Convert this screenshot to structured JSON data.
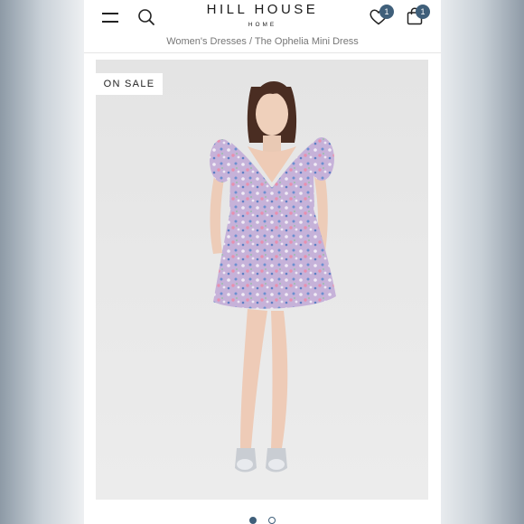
{
  "brand": {
    "name": "HILL HOUSE",
    "tagline": "HOME"
  },
  "header": {
    "menu_icon": "hamburger-menu-icon",
    "search_icon": "search-icon",
    "wishlist_icon": "heart-icon",
    "wishlist_count": "1",
    "cart_icon": "shopping-bag-icon",
    "cart_count": "1"
  },
  "breadcrumb": {
    "parent": "Women's Dresses",
    "separator": "/",
    "current": "The Ophelia Mini Dress"
  },
  "product": {
    "sale_badge": "ON SALE",
    "image_alt": "Model wearing a short-sleeved lavender floral print mini dress",
    "gallery": {
      "total": 2,
      "active_index": 0
    }
  },
  "colors": {
    "accent": "#3f5f7a",
    "dress_base": "#c7b3d8",
    "image_bg": "#e6e6e6"
  }
}
